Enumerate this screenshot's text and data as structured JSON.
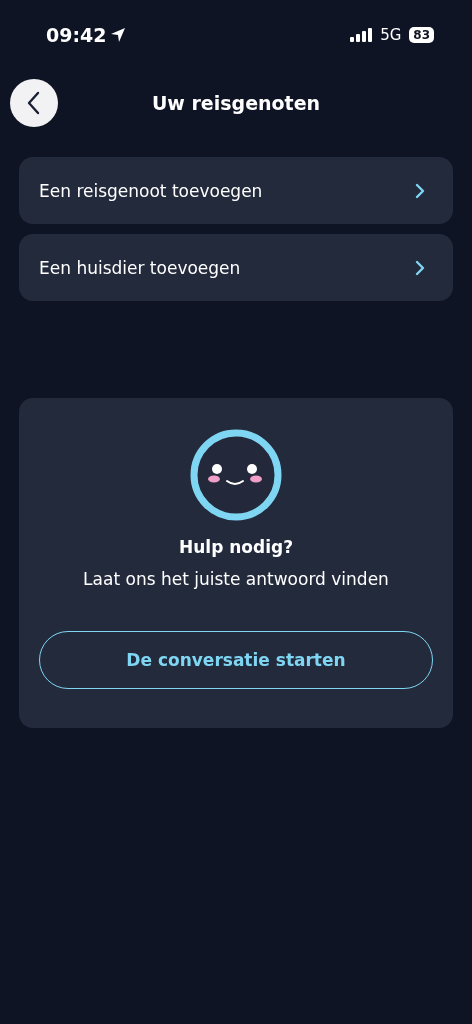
{
  "status_bar": {
    "time": "09:42",
    "network": "5G",
    "battery": "83"
  },
  "header": {
    "title": "Uw reisgenoten"
  },
  "menu": [
    {
      "label": "Een reisgenoot toevoegen"
    },
    {
      "label": "Een huisdier toevoegen"
    }
  ],
  "help": {
    "title": "Hulp nodig?",
    "subtitle": "Laat ons het juiste antwoord vinden",
    "button": "De conversatie starten"
  }
}
